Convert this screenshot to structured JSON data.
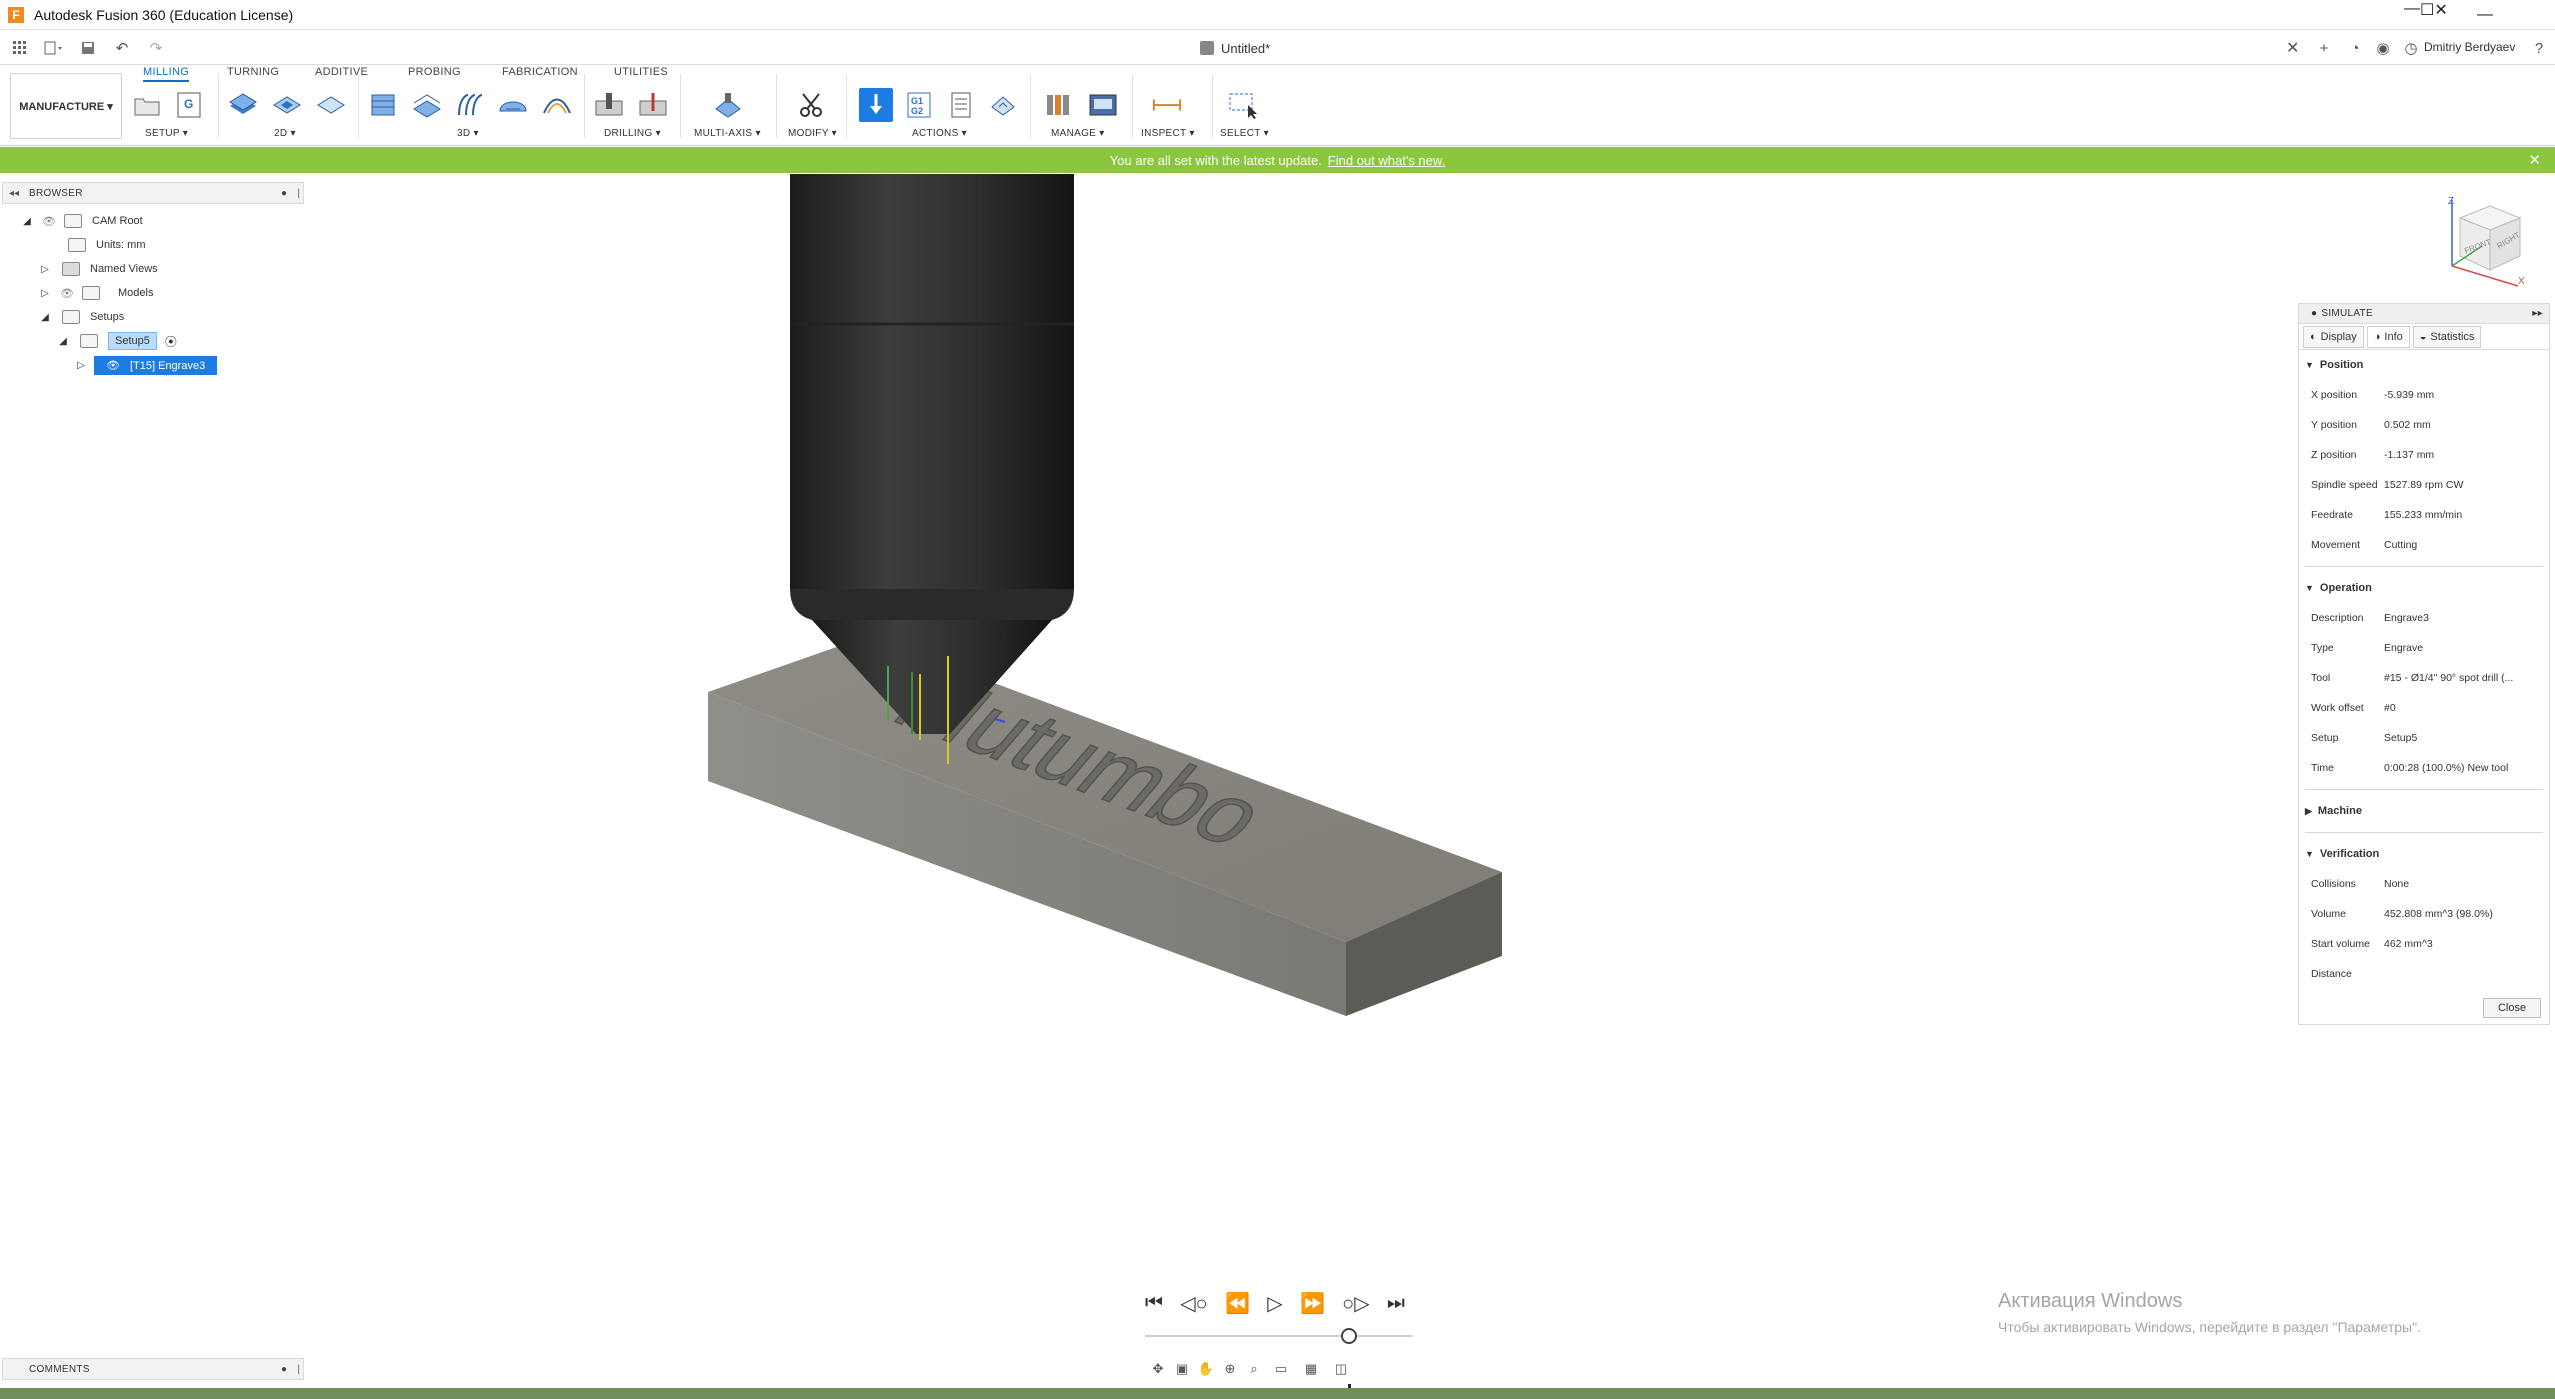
{
  "window": {
    "title": "Autodesk Fusion 360 (Education License)",
    "app_icon": "F",
    "controls": {
      "minimize": "—",
      "maximize": "☐",
      "close": "✕"
    }
  },
  "quick_access": {
    "document_title": "Untitled*",
    "document_close": "✕",
    "user": "Dmitriy Berdyaev"
  },
  "ribbon": {
    "workspace": "MANUFACTURE ▾",
    "tabs": [
      "MILLING",
      "TURNING",
      "ADDITIVE",
      "PROBING",
      "FABRICATION",
      "UTILITIES"
    ],
    "active_tab": "MILLING",
    "groups": {
      "setup": "SETUP ▾",
      "twod": "2D ▾",
      "threed": "3D ▾",
      "drilling": "DRILLING ▾",
      "multiaxis": "MULTI-AXIS ▾",
      "modify": "MODIFY ▾",
      "actions": "ACTIONS ▾",
      "manage": "MANAGE ▾",
      "inspect": "INSPECT ▾",
      "select": "SELECT ▾"
    },
    "g1g2_label": "G1\nG2",
    "nc_label": "G",
    "accent": "#0b6fd0"
  },
  "banner": {
    "text": "You are all set with the latest update.",
    "link": "Find out what's new.",
    "close": "✕",
    "color": "#8cc63f"
  },
  "browser": {
    "header": "BROWSER",
    "items": {
      "root": "CAM Root",
      "units": "Units: mm",
      "named_views": "Named Views",
      "models": "Models",
      "setups": "Setups",
      "setup5": "Setup5",
      "operation": "[T15] Engrave3"
    }
  },
  "comments": {
    "header": "COMMENTS"
  },
  "viewport": {
    "engraved_text": "Mutumbo",
    "viewcube": {
      "front": "FRONT",
      "right": "RIGHT",
      "z": "Z",
      "x": "X"
    }
  },
  "simulate": {
    "title": "SIMULATE",
    "tabs": [
      "Display",
      "Info",
      "Statistics"
    ],
    "active_tab": "Info",
    "position": {
      "header": "Position",
      "rows": [
        {
          "k": "X position",
          "v": "-5.939 mm"
        },
        {
          "k": "Y position",
          "v": "0.502 mm"
        },
        {
          "k": "Z position",
          "v": "-1.137 mm"
        },
        {
          "k": "Spindle speed",
          "v": "1527.89 rpm CW"
        },
        {
          "k": "Feedrate",
          "v": "155.233 mm/min"
        },
        {
          "k": "Movement",
          "v": "Cutting"
        }
      ]
    },
    "operation": {
      "header": "Operation",
      "rows": [
        {
          "k": "Description",
          "v": "Engrave3"
        },
        {
          "k": "Type",
          "v": "Engrave"
        },
        {
          "k": "Tool",
          "v": "#15 - Ø1/4\" 90° spot drill (..."
        },
        {
          "k": "Work offset",
          "v": "#0"
        },
        {
          "k": "Setup",
          "v": "Setup5"
        },
        {
          "k": "Time",
          "v": "0:00:28 (100.0%) New tool"
        }
      ]
    },
    "machine": {
      "header": "Machine"
    },
    "verification": {
      "header": "Verification",
      "rows": [
        {
          "k": "Collisions",
          "v": "None"
        },
        {
          "k": "Volume",
          "v": "452.808 mm^3 (98.0%)"
        },
        {
          "k": "Start volume",
          "v": "462 mm^3"
        },
        {
          "k": "Distance",
          "v": ""
        }
      ]
    },
    "close": "Close"
  },
  "playback": {
    "first": "|◁◁",
    "prev_op": "◁○",
    "prev": "◁◁",
    "play": "▷",
    "next": "▷▷",
    "next_op": "○▷",
    "last": "▷▷|",
    "progress": 0.76
  },
  "activation": {
    "line1": "Активация Windows",
    "line2": "Чтобы активировать Windows, перейдите в раздел \"Параметры\"."
  }
}
